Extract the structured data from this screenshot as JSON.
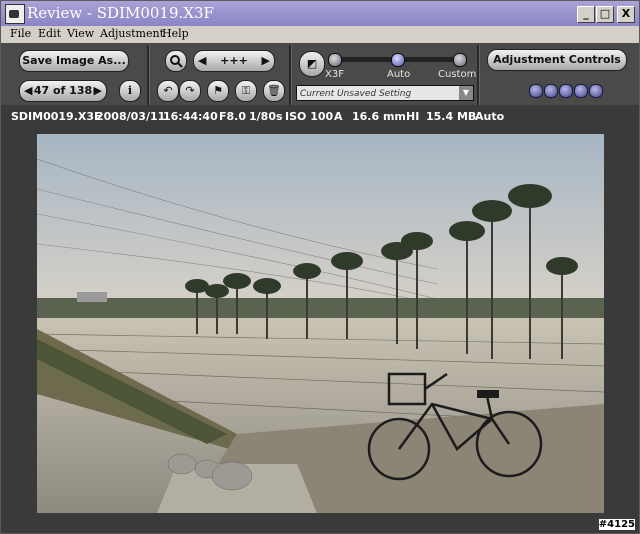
{
  "window": {
    "title": "Review - SDIM0019.X3F",
    "min_symbol": "_",
    "max_symbol": "□",
    "close_symbol": "X"
  },
  "menu": [
    "File",
    "Edit",
    "View",
    "Adjustment",
    "Help"
  ],
  "toolbar": {
    "save_label": "Save Image As...",
    "nav_counter": "47 of 138",
    "info_symbol": "i",
    "zoom_value": "+++",
    "adjustment_label": "Adjustment Controls",
    "slider": {
      "labels": [
        "X3F",
        "Auto",
        "Custom"
      ],
      "selected": "Auto"
    },
    "setting_select": "Current Unsaved Setting"
  },
  "info_fields": [
    "SDIM0019.X3F",
    "2008/03/11",
    "16:44:40",
    "F8.0",
    "1/80s",
    "ISO 100",
    "A",
    "16.6 mm",
    "HI",
    "15.4 MB",
    "Auto"
  ],
  "watermark": "#4125",
  "colors": {
    "titlebar": "#8b84c6",
    "toolbar": "#4a4a4a",
    "accent_dots": "#6060b0"
  }
}
